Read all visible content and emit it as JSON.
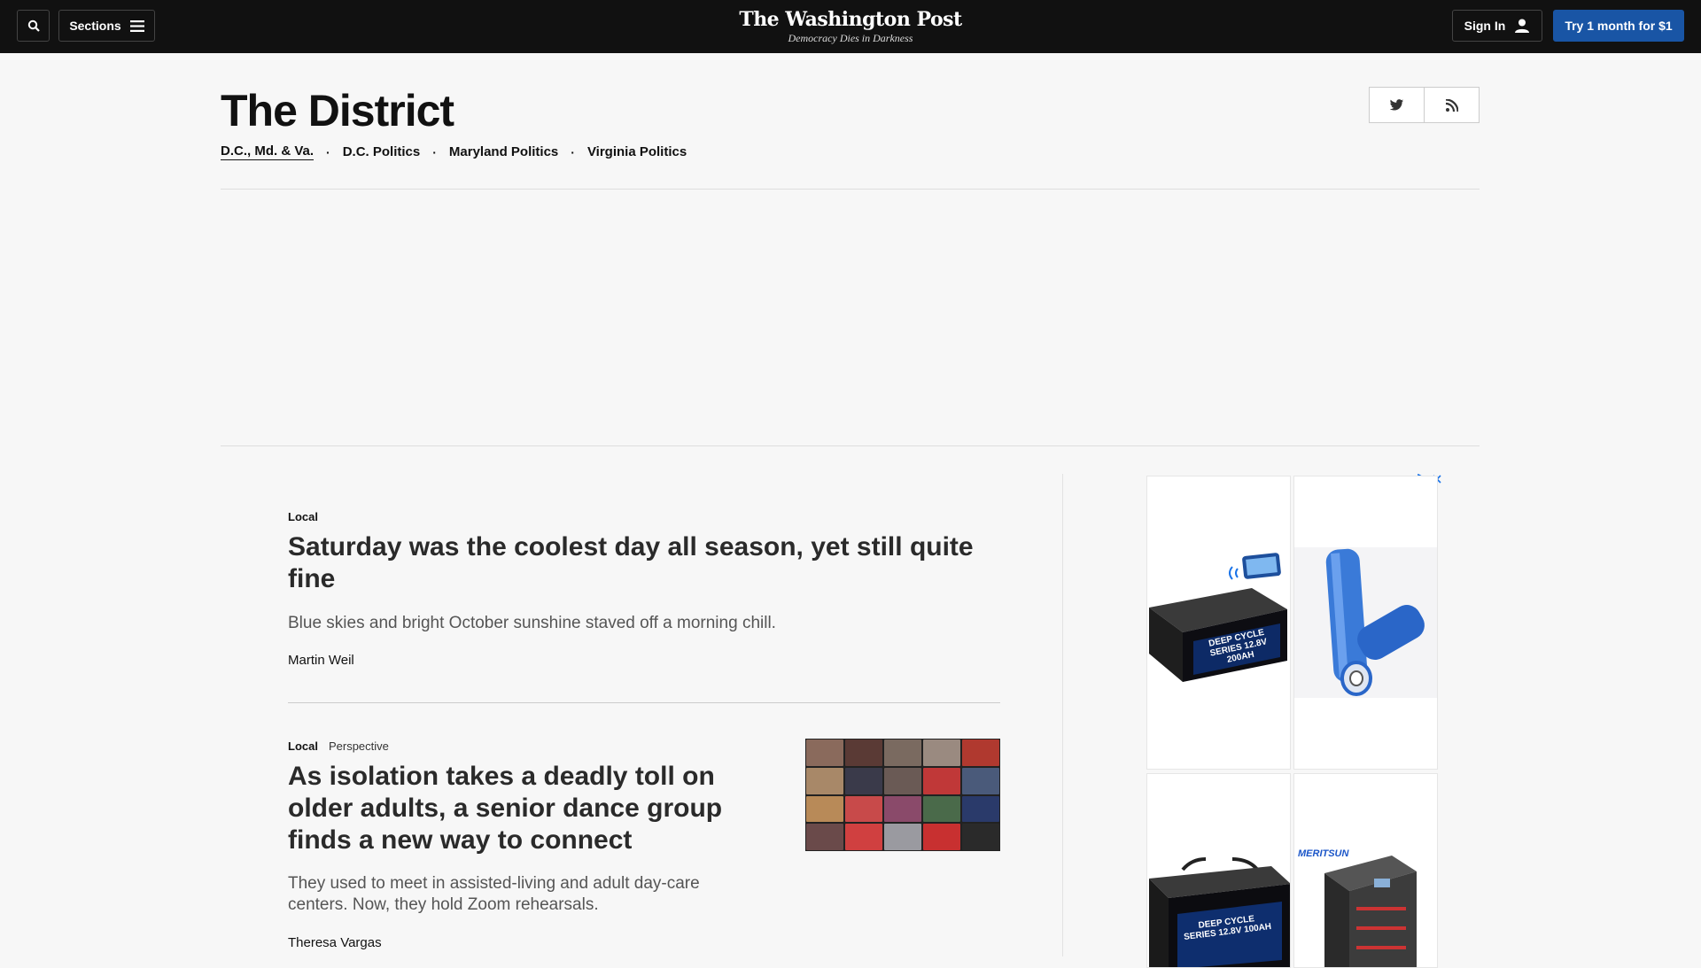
{
  "topbar": {
    "sections_label": "Sections",
    "logo_title": "The Washington Post",
    "logo_tagline": "Democracy Dies in Darkness",
    "signin_label": "Sign In",
    "trial_label": "Try 1 month for $1"
  },
  "header": {
    "title": "The District",
    "subnav": [
      {
        "label": "D.C., Md. & Va."
      },
      {
        "label": "D.C. Politics"
      },
      {
        "label": "Maryland Politics"
      },
      {
        "label": "Virginia Politics"
      }
    ]
  },
  "stories": [
    {
      "kicker": "Local",
      "headline": "Saturday was the coolest day all season, yet still quite fine",
      "blurb": "Blue skies and bright October sunshine staved off a morning chill.",
      "byline": "Martin Weil"
    },
    {
      "kicker": "Local",
      "kicker_sub": "Perspective",
      "headline_lines": [
        "As isolation takes a deadly toll on",
        "older adults, a senior dance group",
        "finds a new way to connect"
      ],
      "blurb_lines": [
        "They used to meet in assisted-living and adult day-care",
        "centers. Now, they hold Zoom rehearsals."
      ],
      "byline": "Theresa Vargas"
    }
  ],
  "ad": {
    "tiles": [
      {
        "text": "DEEP CYCLE SERIES 12.8V 200AH"
      },
      {
        "text": ""
      },
      {
        "text": "DEEP CYCLE SERIES 12.8V 100AH"
      },
      {
        "text": "MERITSUN"
      }
    ]
  },
  "colors": {
    "topbar": "#111111",
    "trial_button": "#1955a5",
    "ad_accent": "#1a73e8"
  }
}
